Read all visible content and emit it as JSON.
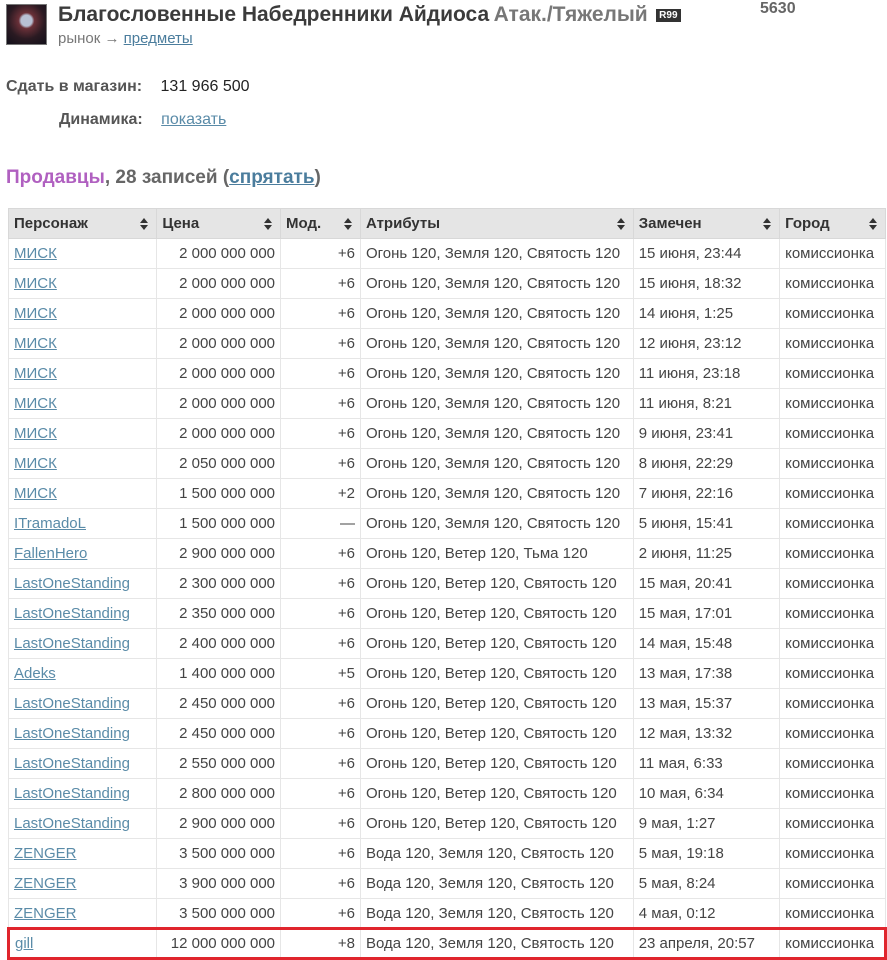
{
  "item": {
    "icon": "armor-icon",
    "name": "Благословенные Набедренники Айдиоса",
    "type": "Атак./Тяжелый",
    "rank": "R99",
    "id": "5630"
  },
  "breadcrumb": {
    "root": "рынок",
    "arrow": "→",
    "current": "предметы"
  },
  "info": {
    "sell_label": "Сдать в магазин:",
    "sell_value": "131 966 500",
    "dynamics_label": "Динамика:",
    "dynamics_link": "показать"
  },
  "section": {
    "title": "Продавцы",
    "count_text": ", 28 записей (",
    "toggle": "спрятать",
    "close": ")"
  },
  "table": {
    "headers": [
      "Персонаж",
      "Цена",
      "Мод.",
      "Атрибуты",
      "Замечен",
      "Город"
    ],
    "rows": [
      [
        "МИСК",
        "2 000 000 000",
        "+6",
        "Огонь 120, Земля 120, Святость 120",
        "15 июня, 23:44",
        "комиссионка"
      ],
      [
        "МИСК",
        "2 000 000 000",
        "+6",
        "Огонь 120, Земля 120, Святость 120",
        "15 июня, 18:32",
        "комиссионка"
      ],
      [
        "МИСК",
        "2 000 000 000",
        "+6",
        "Огонь 120, Земля 120, Святость 120",
        "14 июня, 1:25",
        "комиссионка"
      ],
      [
        "МИСК",
        "2 000 000 000",
        "+6",
        "Огонь 120, Земля 120, Святость 120",
        "12 июня, 23:12",
        "комиссионка"
      ],
      [
        "МИСК",
        "2 000 000 000",
        "+6",
        "Огонь 120, Земля 120, Святость 120",
        "11 июня, 23:18",
        "комиссионка"
      ],
      [
        "МИСК",
        "2 000 000 000",
        "+6",
        "Огонь 120, Земля 120, Святость 120",
        "11 июня, 8:21",
        "комиссионка"
      ],
      [
        "МИСК",
        "2 000 000 000",
        "+6",
        "Огонь 120, Земля 120, Святость 120",
        "9 июня, 23:41",
        "комиссионка"
      ],
      [
        "МИСК",
        "2 050 000 000",
        "+6",
        "Огонь 120, Земля 120, Святость 120",
        "8 июня, 22:29",
        "комиссионка"
      ],
      [
        "МИСК",
        "1 500 000 000",
        "+2",
        "Огонь 120, Земля 120, Святость 120",
        "7 июня, 22:16",
        "комиссионка"
      ],
      [
        "ITramadoL",
        "1 500 000 000",
        "—",
        "Огонь 120, Земля 120, Святость 120",
        "5 июня, 15:41",
        "комиссионка"
      ],
      [
        "FallenHero",
        "2 900 000 000",
        "+6",
        "Огонь 120, Ветер 120, Тьма 120",
        "2 июня, 11:25",
        "комиссионка"
      ],
      [
        "LastOneStanding",
        "2 300 000 000",
        "+6",
        "Огонь 120, Ветер 120, Святость 120",
        "15 мая, 20:41",
        "комиссионка"
      ],
      [
        "LastOneStanding",
        "2 350 000 000",
        "+6",
        "Огонь 120, Ветер 120, Святость 120",
        "15 мая, 17:01",
        "комиссионка"
      ],
      [
        "LastOneStanding",
        "2 400 000 000",
        "+6",
        "Огонь 120, Ветер 120, Святость 120",
        "14 мая, 15:48",
        "комиссионка"
      ],
      [
        "Adeks",
        "1 400 000 000",
        "+5",
        "Огонь 120, Ветер 120, Святость 120",
        "13 мая, 17:38",
        "комиссионка"
      ],
      [
        "LastOneStanding",
        "2 450 000 000",
        "+6",
        "Огонь 120, Ветер 120, Святость 120",
        "13 мая, 15:37",
        "комиссионка"
      ],
      [
        "LastOneStanding",
        "2 450 000 000",
        "+6",
        "Огонь 120, Ветер 120, Святость 120",
        "12 мая, 13:32",
        "комиссионка"
      ],
      [
        "LastOneStanding",
        "2 550 000 000",
        "+6",
        "Огонь 120, Ветер 120, Святость 120",
        "11 мая, 6:33",
        "комиссионка"
      ],
      [
        "LastOneStanding",
        "2 800 000 000",
        "+6",
        "Огонь 120, Ветер 120, Святость 120",
        "10 мая, 6:34",
        "комиссионка"
      ],
      [
        "LastOneStanding",
        "2 900 000 000",
        "+6",
        "Огонь 120, Ветер 120, Святость 120",
        "9 мая, 1:27",
        "комиссионка"
      ],
      [
        "ZENGER",
        "3 500 000 000",
        "+6",
        "Вода 120, Земля 120, Святость 120",
        "5 мая, 19:18",
        "комиссионка"
      ],
      [
        "ZENGER",
        "3 900 000 000",
        "+6",
        "Вода 120, Земля 120, Святость 120",
        "5 мая, 8:24",
        "комиссионка"
      ],
      [
        "ZENGER",
        "3 500 000 000",
        "+6",
        "Вода 120, Земля 120, Святость 120",
        "4 мая, 0:12",
        "комиссионка"
      ],
      [
        "gill",
        "12 000 000 000",
        "+8",
        "Вода 120, Земля 120, Святость 120",
        "23 апреля, 20:57",
        "комиссионка"
      ]
    ],
    "highlighted_row": 23,
    "highlight_color": "#e0252d"
  },
  "colors": {
    "link": "#5a8ba8",
    "sellers_title": "#b060c0",
    "header_bg": "#e5e5e5"
  }
}
